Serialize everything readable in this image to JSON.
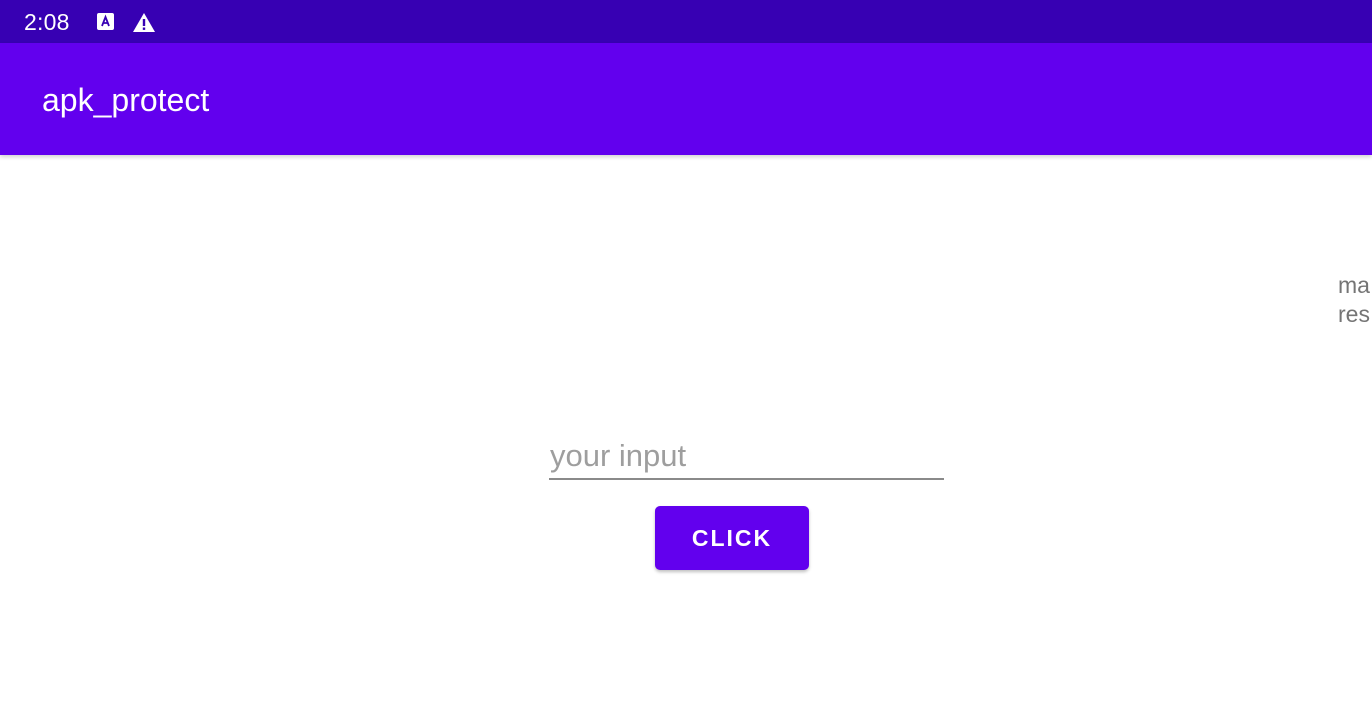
{
  "status_bar": {
    "time": "2:08",
    "icons": [
      "accessibility-notification-icon",
      "warning-icon"
    ],
    "color": "#3700b3"
  },
  "app_bar": {
    "title": "apk_protect",
    "color": "#6200ee"
  },
  "side_text": {
    "line1": "ma",
    "line2": "res"
  },
  "input": {
    "placeholder": "your input",
    "value": ""
  },
  "button": {
    "label": "CLICK",
    "color": "#6200ee"
  }
}
